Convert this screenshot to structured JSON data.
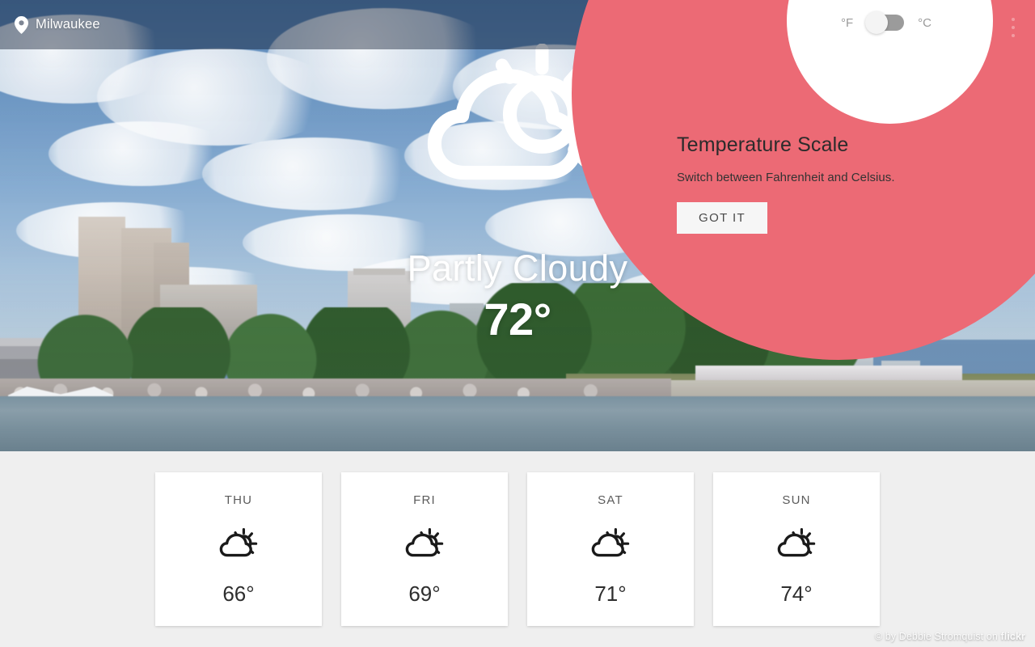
{
  "header": {
    "location": "Milwaukee",
    "location_icon": "map-pin-icon",
    "overflow_icon": "more-vertical-icon"
  },
  "temperature_toggle": {
    "left_label": "°F",
    "right_label": "°C",
    "selected": "°F",
    "track_color": "#9b9b9b",
    "knob_color": "#f4f4f4"
  },
  "coach_mark": {
    "title": "Temperature Scale",
    "description": "Switch between Fahrenheit and Celsius.",
    "button_label": "GOT IT",
    "background_color": "#ec6a75",
    "button_background": "#f6f6f6"
  },
  "current": {
    "condition": "Partly Cloudy",
    "temperature": "72°",
    "icon": "partly-cloudy-icon"
  },
  "photo_credit": {
    "prefix": "© by Debbie Stromquist on ",
    "source": "flickr"
  },
  "forecast": {
    "days": [
      {
        "day": "THU",
        "temp": "66°",
        "icon": "partly-cloudy-icon"
      },
      {
        "day": "FRI",
        "temp": "69°",
        "icon": "partly-cloudy-icon"
      },
      {
        "day": "SAT",
        "temp": "71°",
        "icon": "partly-cloudy-icon"
      },
      {
        "day": "SUN",
        "temp": "74°",
        "icon": "partly-cloudy-icon"
      }
    ]
  },
  "colors": {
    "accent_pink": "#ec6a75",
    "page_background": "#efefef",
    "card_background": "#ffffff"
  }
}
